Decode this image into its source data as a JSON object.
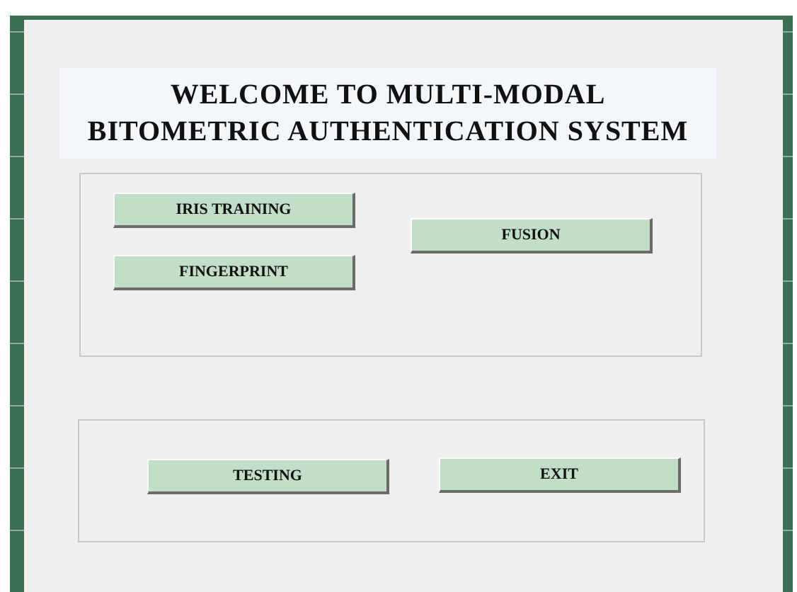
{
  "title_lines": [
    "WELCOME TO MULTI-MODAL",
    "BITOMETRIC AUTHENTICATION SYSTEM"
  ],
  "training_panel": {
    "buttons": [
      {
        "label": "IRIS TRAINING"
      },
      {
        "label": "FINGERPRINT"
      },
      {
        "label": "FUSION"
      }
    ]
  },
  "action_panel": {
    "buttons": [
      {
        "label": "TESTING"
      },
      {
        "label": "EXIT"
      }
    ]
  }
}
